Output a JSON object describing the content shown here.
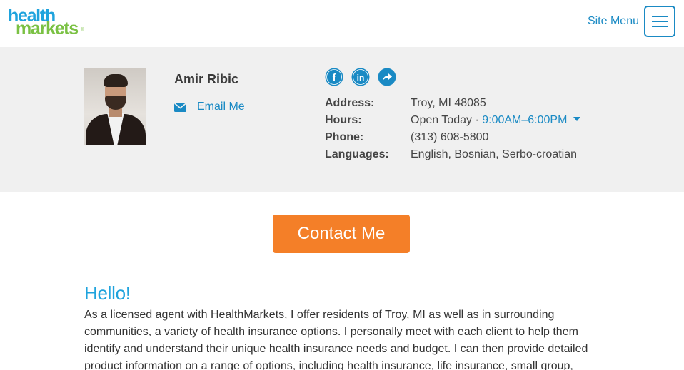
{
  "header": {
    "logo_line1": "health",
    "logo_line2": "markets",
    "logo_tm": "®",
    "site_menu_label": "Site Menu",
    "menu_icon": "hamburger-menu-icon"
  },
  "agent": {
    "name": "Amir Ribic",
    "email_label": "Email Me",
    "email_icon": "envelope-icon",
    "social": [
      {
        "name": "facebook-icon",
        "glyph": "f"
      },
      {
        "name": "linkedin-icon",
        "glyph": "in"
      },
      {
        "name": "share-icon",
        "glyph": "share"
      }
    ],
    "details": {
      "address_label": "Address:",
      "address_value": "Troy, MI 48085",
      "hours_label": "Hours:",
      "hours_status": "Open Today · ",
      "hours_range": "9:00AM–6:00PM",
      "phone_label": "Phone:",
      "phone_value": "(313) 608-5800",
      "languages_label": "Languages:",
      "languages_value": "English, Bosnian, Serbo-croatian"
    }
  },
  "contact_button": "Contact Me",
  "hello_title": "Hello!",
  "bio": "As a licensed agent with HealthMarkets, I offer residents of Troy, MI as well as in surrounding communities, a variety of health insurance options. I personally meet with each client to help them identify and understand their unique health insurance needs and budget. I can then provide detailed product information on a range of options, including health insurance, life insurance, small group,",
  "colors": {
    "brand_blue": "#1a8ac4",
    "brand_green": "#7ac143",
    "cta_orange": "#f47f28",
    "band_gray": "#f0f0f0"
  }
}
